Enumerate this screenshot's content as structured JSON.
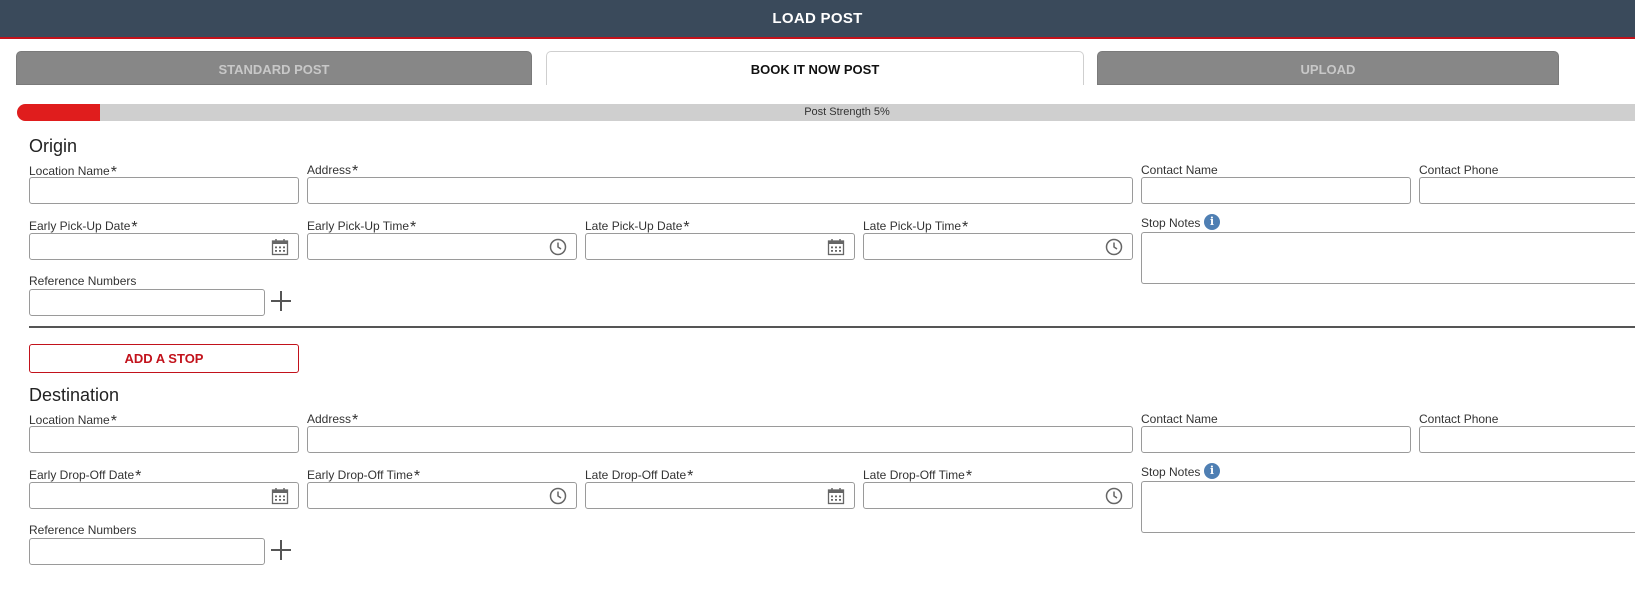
{
  "header": {
    "title": "LOAD POST"
  },
  "tabs": [
    {
      "label": "STANDARD POST",
      "active": false
    },
    {
      "label": "BOOK IT NOW POST",
      "active": true
    },
    {
      "label": "UPLOAD",
      "active": false
    }
  ],
  "post_strength": {
    "label": "Post Strength 5%",
    "percent": 5
  },
  "origin": {
    "title": "Origin",
    "location_name": "Location Name",
    "address": "Address",
    "contact_name": "Contact Name",
    "contact_phone": "Contact Phone",
    "early_date": "Early Pick-Up Date",
    "early_time": "Early Pick-Up Time",
    "late_date": "Late Pick-Up Date",
    "late_time": "Late Pick-Up Time",
    "stop_notes": "Stop Notes",
    "reference_numbers": "Reference Numbers"
  },
  "add_stop_label": "ADD A STOP",
  "destination": {
    "title": "Destination",
    "location_name": "Location Name",
    "address": "Address",
    "contact_name": "Contact Name",
    "contact_phone": "Contact Phone",
    "early_date": "Early Drop-Off Date",
    "early_time": "Early Drop-Off Time",
    "late_date": "Late Drop-Off Date",
    "late_time": "Late Drop-Off Time",
    "stop_notes": "Stop Notes",
    "reference_numbers": "Reference Numbers"
  },
  "required_marker": "*",
  "info_glyph": "i",
  "icons": {
    "date": "calendar-icon",
    "time": "clock-icon",
    "notes": "info-icon",
    "add": "plus-icon"
  },
  "colors": {
    "header_bg": "#3a4a5b",
    "accent_red": "#c2121b",
    "progress_fill": "#e01d1d",
    "tab_inactive": "#878787",
    "info_blue": "#4f7fb3"
  }
}
